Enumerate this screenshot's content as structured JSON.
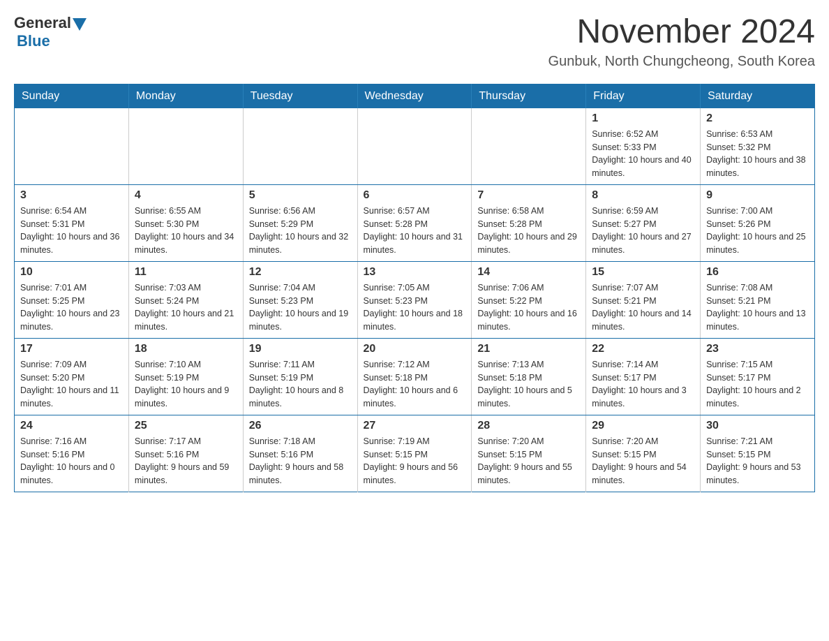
{
  "header": {
    "logo": {
      "general": "General",
      "blue": "Blue",
      "arrow_color": "#1a6ea8"
    },
    "title": "November 2024",
    "location": "Gunbuk, North Chungcheong, South Korea"
  },
  "calendar": {
    "weekdays": [
      "Sunday",
      "Monday",
      "Tuesday",
      "Wednesday",
      "Thursday",
      "Friday",
      "Saturday"
    ],
    "weeks": [
      [
        {
          "day": "",
          "sunrise": "",
          "sunset": "",
          "daylight": ""
        },
        {
          "day": "",
          "sunrise": "",
          "sunset": "",
          "daylight": ""
        },
        {
          "day": "",
          "sunrise": "",
          "sunset": "",
          "daylight": ""
        },
        {
          "day": "",
          "sunrise": "",
          "sunset": "",
          "daylight": ""
        },
        {
          "day": "",
          "sunrise": "",
          "sunset": "",
          "daylight": ""
        },
        {
          "day": "1",
          "sunrise": "Sunrise: 6:52 AM",
          "sunset": "Sunset: 5:33 PM",
          "daylight": "Daylight: 10 hours and 40 minutes."
        },
        {
          "day": "2",
          "sunrise": "Sunrise: 6:53 AM",
          "sunset": "Sunset: 5:32 PM",
          "daylight": "Daylight: 10 hours and 38 minutes."
        }
      ],
      [
        {
          "day": "3",
          "sunrise": "Sunrise: 6:54 AM",
          "sunset": "Sunset: 5:31 PM",
          "daylight": "Daylight: 10 hours and 36 minutes."
        },
        {
          "day": "4",
          "sunrise": "Sunrise: 6:55 AM",
          "sunset": "Sunset: 5:30 PM",
          "daylight": "Daylight: 10 hours and 34 minutes."
        },
        {
          "day": "5",
          "sunrise": "Sunrise: 6:56 AM",
          "sunset": "Sunset: 5:29 PM",
          "daylight": "Daylight: 10 hours and 32 minutes."
        },
        {
          "day": "6",
          "sunrise": "Sunrise: 6:57 AM",
          "sunset": "Sunset: 5:28 PM",
          "daylight": "Daylight: 10 hours and 31 minutes."
        },
        {
          "day": "7",
          "sunrise": "Sunrise: 6:58 AM",
          "sunset": "Sunset: 5:28 PM",
          "daylight": "Daylight: 10 hours and 29 minutes."
        },
        {
          "day": "8",
          "sunrise": "Sunrise: 6:59 AM",
          "sunset": "Sunset: 5:27 PM",
          "daylight": "Daylight: 10 hours and 27 minutes."
        },
        {
          "day": "9",
          "sunrise": "Sunrise: 7:00 AM",
          "sunset": "Sunset: 5:26 PM",
          "daylight": "Daylight: 10 hours and 25 minutes."
        }
      ],
      [
        {
          "day": "10",
          "sunrise": "Sunrise: 7:01 AM",
          "sunset": "Sunset: 5:25 PM",
          "daylight": "Daylight: 10 hours and 23 minutes."
        },
        {
          "day": "11",
          "sunrise": "Sunrise: 7:03 AM",
          "sunset": "Sunset: 5:24 PM",
          "daylight": "Daylight: 10 hours and 21 minutes."
        },
        {
          "day": "12",
          "sunrise": "Sunrise: 7:04 AM",
          "sunset": "Sunset: 5:23 PM",
          "daylight": "Daylight: 10 hours and 19 minutes."
        },
        {
          "day": "13",
          "sunrise": "Sunrise: 7:05 AM",
          "sunset": "Sunset: 5:23 PM",
          "daylight": "Daylight: 10 hours and 18 minutes."
        },
        {
          "day": "14",
          "sunrise": "Sunrise: 7:06 AM",
          "sunset": "Sunset: 5:22 PM",
          "daylight": "Daylight: 10 hours and 16 minutes."
        },
        {
          "day": "15",
          "sunrise": "Sunrise: 7:07 AM",
          "sunset": "Sunset: 5:21 PM",
          "daylight": "Daylight: 10 hours and 14 minutes."
        },
        {
          "day": "16",
          "sunrise": "Sunrise: 7:08 AM",
          "sunset": "Sunset: 5:21 PM",
          "daylight": "Daylight: 10 hours and 13 minutes."
        }
      ],
      [
        {
          "day": "17",
          "sunrise": "Sunrise: 7:09 AM",
          "sunset": "Sunset: 5:20 PM",
          "daylight": "Daylight: 10 hours and 11 minutes."
        },
        {
          "day": "18",
          "sunrise": "Sunrise: 7:10 AM",
          "sunset": "Sunset: 5:19 PM",
          "daylight": "Daylight: 10 hours and 9 minutes."
        },
        {
          "day": "19",
          "sunrise": "Sunrise: 7:11 AM",
          "sunset": "Sunset: 5:19 PM",
          "daylight": "Daylight: 10 hours and 8 minutes."
        },
        {
          "day": "20",
          "sunrise": "Sunrise: 7:12 AM",
          "sunset": "Sunset: 5:18 PM",
          "daylight": "Daylight: 10 hours and 6 minutes."
        },
        {
          "day": "21",
          "sunrise": "Sunrise: 7:13 AM",
          "sunset": "Sunset: 5:18 PM",
          "daylight": "Daylight: 10 hours and 5 minutes."
        },
        {
          "day": "22",
          "sunrise": "Sunrise: 7:14 AM",
          "sunset": "Sunset: 5:17 PM",
          "daylight": "Daylight: 10 hours and 3 minutes."
        },
        {
          "day": "23",
          "sunrise": "Sunrise: 7:15 AM",
          "sunset": "Sunset: 5:17 PM",
          "daylight": "Daylight: 10 hours and 2 minutes."
        }
      ],
      [
        {
          "day": "24",
          "sunrise": "Sunrise: 7:16 AM",
          "sunset": "Sunset: 5:16 PM",
          "daylight": "Daylight: 10 hours and 0 minutes."
        },
        {
          "day": "25",
          "sunrise": "Sunrise: 7:17 AM",
          "sunset": "Sunset: 5:16 PM",
          "daylight": "Daylight: 9 hours and 59 minutes."
        },
        {
          "day": "26",
          "sunrise": "Sunrise: 7:18 AM",
          "sunset": "Sunset: 5:16 PM",
          "daylight": "Daylight: 9 hours and 58 minutes."
        },
        {
          "day": "27",
          "sunrise": "Sunrise: 7:19 AM",
          "sunset": "Sunset: 5:15 PM",
          "daylight": "Daylight: 9 hours and 56 minutes."
        },
        {
          "day": "28",
          "sunrise": "Sunrise: 7:20 AM",
          "sunset": "Sunset: 5:15 PM",
          "daylight": "Daylight: 9 hours and 55 minutes."
        },
        {
          "day": "29",
          "sunrise": "Sunrise: 7:20 AM",
          "sunset": "Sunset: 5:15 PM",
          "daylight": "Daylight: 9 hours and 54 minutes."
        },
        {
          "day": "30",
          "sunrise": "Sunrise: 7:21 AM",
          "sunset": "Sunset: 5:15 PM",
          "daylight": "Daylight: 9 hours and 53 minutes."
        }
      ]
    ]
  }
}
